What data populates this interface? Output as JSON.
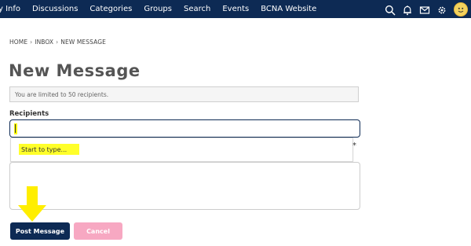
{
  "nav": {
    "items": [
      "y Info",
      "Discussions",
      "Categories",
      "Groups",
      "Search",
      "Events",
      "BCNA Website"
    ],
    "icons": [
      "search-icon",
      "bell-icon",
      "mail-icon",
      "gear-icon",
      "avatar"
    ]
  },
  "breadcrumb": [
    "HOME",
    "INBOX",
    "NEW MESSAGE"
  ],
  "page": {
    "title": "New Message"
  },
  "notice": "You are limited to 50 recipients.",
  "recipients": {
    "label": "Recipients",
    "value": "",
    "suggestion": "Start to type..."
  },
  "body": {
    "required_mark": "*"
  },
  "buttons": {
    "post": "Post Message",
    "cancel": "Cancel"
  },
  "colors": {
    "nav_bg": "#0d2a54",
    "primary": "#0d2a54",
    "cancel": "#f7a8c2",
    "highlight": "#ffff00",
    "arrow": "#ffee00"
  }
}
